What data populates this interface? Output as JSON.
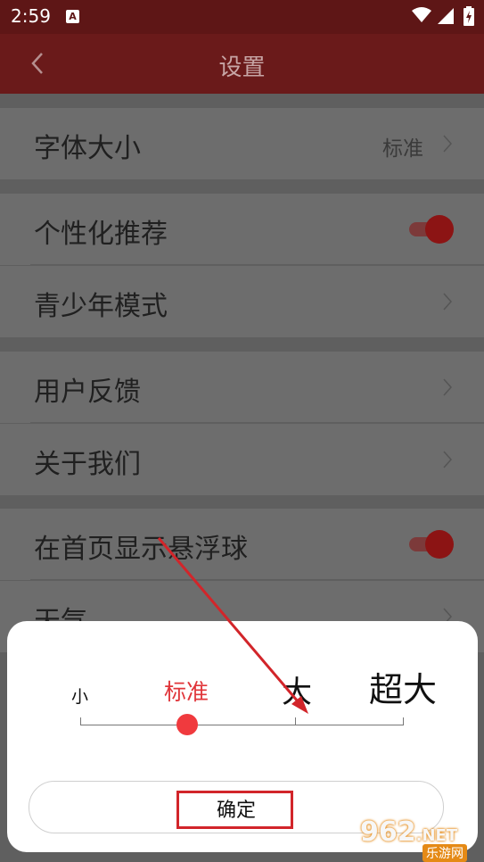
{
  "status_bar": {
    "time": "2:59",
    "notification_icon": "A"
  },
  "app_bar": {
    "title": "设置"
  },
  "settings": {
    "font_size": {
      "label": "字体大小",
      "value": "标准"
    },
    "personalized_recommendation": {
      "label": "个性化推荐",
      "enabled": true
    },
    "teen_mode": {
      "label": "青少年模式"
    },
    "feedback": {
      "label": "用户反馈"
    },
    "about": {
      "label": "关于我们"
    },
    "floating_ball": {
      "label": "在首页显示悬浮球",
      "enabled": true
    },
    "weather": {
      "label": "天气"
    }
  },
  "font_size_dialog": {
    "options": [
      "小",
      "标准",
      "大",
      "超大"
    ],
    "selected": "标准",
    "confirm_label": "确定"
  },
  "colors": {
    "accent": "#f03a3e",
    "app_bar": "#6a1a1a",
    "annotation": "#d2252a"
  },
  "watermark": {
    "logo": "962",
    "logo_suffix": ".NET",
    "subtitle": "乐游网"
  }
}
